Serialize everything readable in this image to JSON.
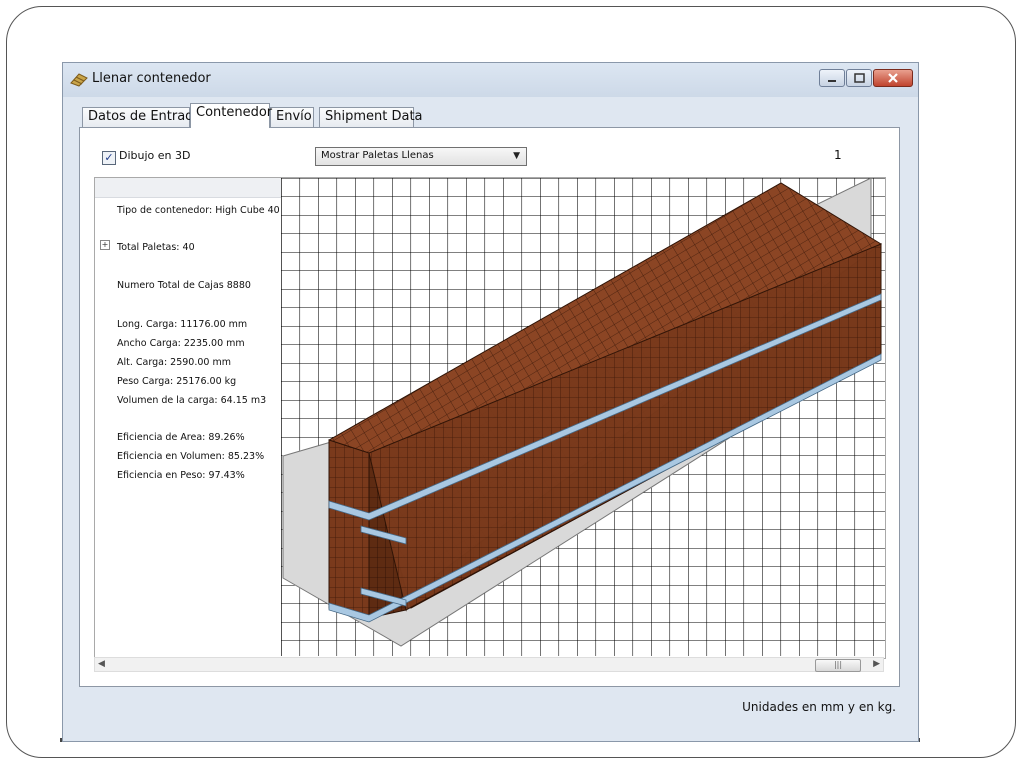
{
  "window": {
    "title": "Llenar contenedor"
  },
  "tabs": [
    {
      "label": "Datos de Entrada",
      "active": false
    },
    {
      "label": "Contenedor",
      "active": true
    },
    {
      "label": "Envío",
      "active": false
    },
    {
      "label": "Shipment Data",
      "active": false
    }
  ],
  "controls": {
    "draw3d_label": "Dibujo en 3D",
    "draw3d_checked": true,
    "display_select_value": "Mostrar Paletas Llenas",
    "page_number": "1"
  },
  "info": {
    "container_type": "Tipo de contenedor: High Cube 40",
    "total_pallets": "Total Paletas: 40",
    "total_boxes": "Numero Total de Cajas 8880",
    "load_length": "Long. Carga: 11176.00 mm",
    "load_width": "Ancho Carga: 2235.00 mm",
    "load_height": "Alt. Carga: 2590.00 mm",
    "load_weight": "Peso Carga: 25176.00 kg",
    "load_volume": "Volumen de la carga: 64.15 m3",
    "area_efficiency": "Eficiencia de Area: 89.26%",
    "volume_efficiency": "Eficiencia en Volumen: 85.23%",
    "weight_efficiency": "Eficiencia en Peso: 97.43%"
  },
  "footer": {
    "units_note": "Unidades en mm y en kg."
  },
  "colors": {
    "box_front": "#7a3a1c",
    "box_top": "#8b4524",
    "box_side": "#5e2b12",
    "pallet": "#a9c8e2",
    "floor": "#d9d9d9",
    "grid": "#000000"
  },
  "icons": {
    "app": "pallet-boxes-icon",
    "expander": "plus-expander-icon"
  }
}
